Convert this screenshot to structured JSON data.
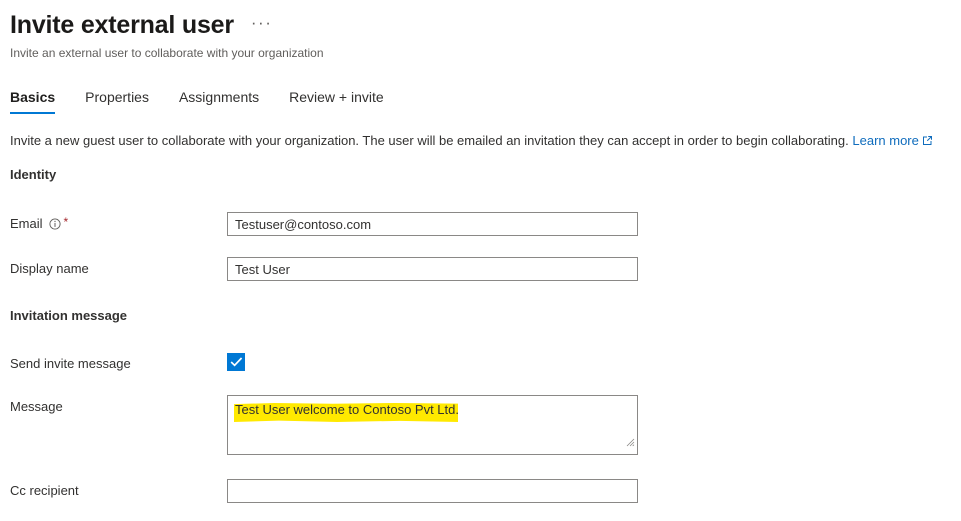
{
  "header": {
    "title": "Invite external user",
    "more_label": "···",
    "subtitle": "Invite an external user to collaborate with your organization"
  },
  "tabs": [
    {
      "label": "Basics",
      "active": true
    },
    {
      "label": "Properties",
      "active": false
    },
    {
      "label": "Assignments",
      "active": false
    },
    {
      "label": "Review + invite",
      "active": false
    }
  ],
  "intro": {
    "text": "Invite a new guest user to collaborate with your organization. The user will be emailed an invitation they can accept in order to begin collaborating.",
    "link_label": "Learn more"
  },
  "sections": {
    "identity": "Identity",
    "invitation_message": "Invitation message"
  },
  "fields": {
    "email": {
      "label": "Email",
      "required_marker": "*",
      "value": "Testuser@contoso.com",
      "placeholder": ""
    },
    "display_name": {
      "label": "Display name",
      "value": "Test User",
      "placeholder": ""
    },
    "send_invite_message": {
      "label": "Send invite message",
      "checked": true
    },
    "message": {
      "label": "Message",
      "value": "Test User welcome to Contoso Pvt Ltd.",
      "placeholder": ""
    },
    "cc_recipient": {
      "label": "Cc recipient",
      "value": "",
      "placeholder": ""
    }
  },
  "colors": {
    "accent": "#0078d4",
    "link": "#0f6cbd",
    "required": "#a4262c",
    "highlight": "#ffe900"
  }
}
